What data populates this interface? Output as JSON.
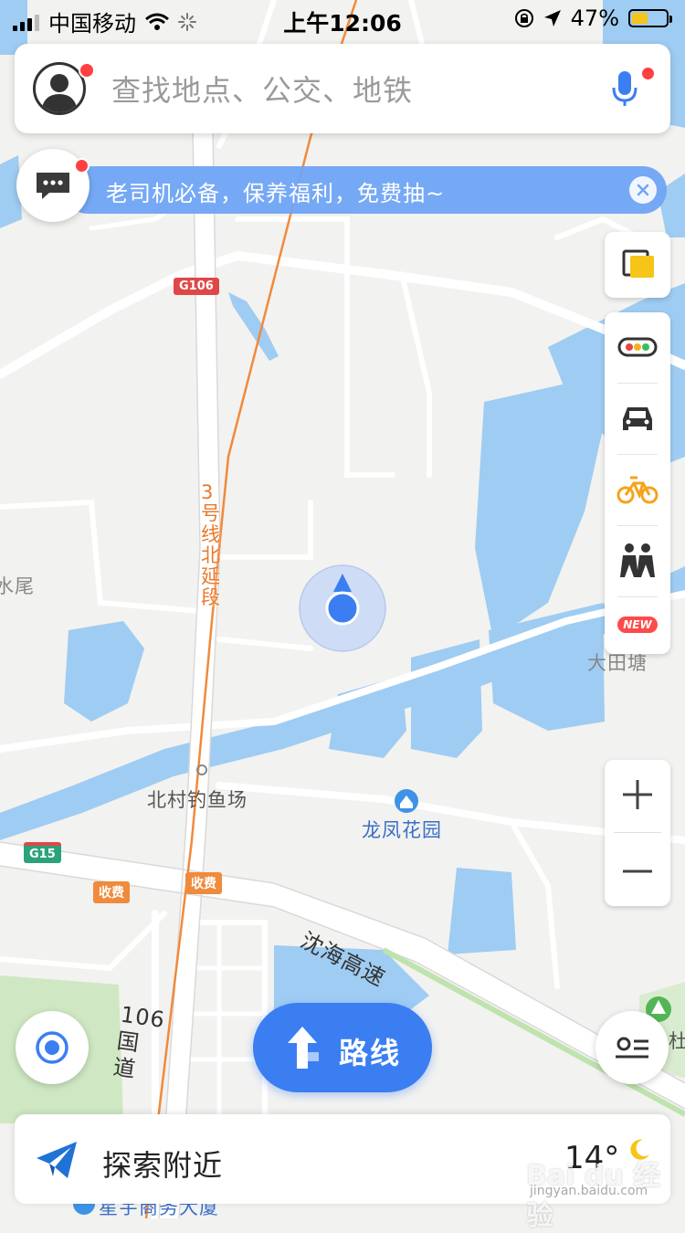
{
  "status_bar": {
    "carrier": "中国移动",
    "time": "上午12:06",
    "battery_text": "47%",
    "battery_level": 0.47
  },
  "search": {
    "placeholder": "查找地点、公交、地铁"
  },
  "banner": {
    "text": "老司机必备，保养福利，免费抽~"
  },
  "side_tools": {
    "new_badge": "NEW"
  },
  "map_labels": {
    "road_g106": "G106",
    "road_g15": "G15",
    "metro_line": "3号线北延段",
    "village_left": "水尾",
    "place_right": "大田塘",
    "fishing": "北村钓鱼场",
    "garden": "龙凤花园",
    "toll_1": "收费",
    "toll_2": "收费",
    "expressway": "沈海高速",
    "national_road": "106国道",
    "bottom_poi": "星宇商务大厦",
    "partial_right": "杜"
  },
  "route_button": {
    "label": "路线"
  },
  "explore": {
    "label": "探索附近",
    "temperature": "14°"
  },
  "watermark": {
    "main": "Bai du 经验",
    "sub": "jingyan.baidu.com"
  },
  "colors": {
    "accent": "#3b7ef2",
    "water": "#9fccf2",
    "metro": "#f08a3c",
    "alert_dot": "#ff4040"
  }
}
